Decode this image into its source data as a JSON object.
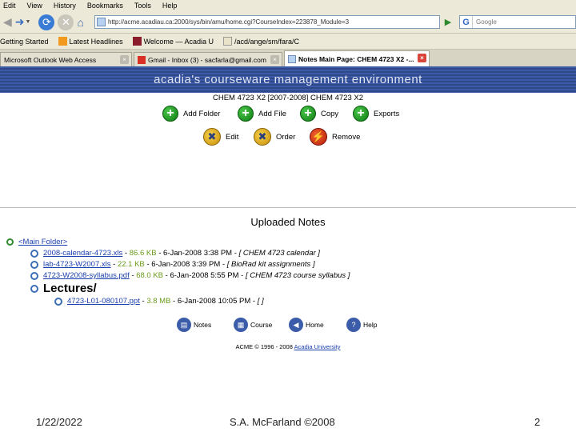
{
  "menu": [
    "Edit",
    "View",
    "History",
    "Bookmarks",
    "Tools",
    "Help"
  ],
  "nav": {
    "url": "http://acme.acadiau.ca:2000/sys/bin/amu/home.cgi?CourseIndex=223878_Module=3",
    "search_placeholder": "Google"
  },
  "bookmarks": [
    "Getting Started",
    "Latest Headlines",
    "Welcome — Acadia U",
    "/acd/ange/sm/fara/C"
  ],
  "tabs": [
    {
      "label": "Microsoft Outlook Web Access",
      "active": false
    },
    {
      "label": "Gmail - Inbox (3) - sacfarla@gmail.com",
      "active": false
    },
    {
      "label": "Notes Main Page: CHEM 4723 X2 -...",
      "active": true
    }
  ],
  "banner": "acadia's courseware management environment",
  "course_title": "CHEM 4723 X2 [2007-2008] CHEM 4723 X2",
  "actions": {
    "add_folder": "Add Folder",
    "add_file": "Add File",
    "copy": "Copy",
    "exports": "Exports",
    "edit": "Edit",
    "order": "Order",
    "remove": "Remove"
  },
  "uploaded_title": "Uploaded Notes",
  "main_folder": "<Main Folder>",
  "files": [
    {
      "name": "2008-calendar-4723.xls",
      "size": "86.6 KB",
      "date": "6-Jan-2008 3:38 PM",
      "desc": "[ CHEM 4723 calendar ]"
    },
    {
      "name": "lab-4723-W2007.xls",
      "size": "22.1 KB",
      "date": "6-Jan-2008 3:39 PM",
      "desc": "[ BioRad kit assignments ]"
    },
    {
      "name": "4723-W2008-syllabus.pdf",
      "size": "68.0 KB",
      "date": "6-Jan-2008 5:55 PM",
      "desc": "[ CHEM 4723 course syllabus ]"
    }
  ],
  "lectures_folder": "Lectures/",
  "lecture_files": [
    {
      "name": "4723-L01-080107.ppt",
      "size": "3.8 MB",
      "date": "6-Jan-2008 10:05 PM",
      "desc": "[ ]"
    }
  ],
  "bottom_nav": {
    "notes": "Notes",
    "course": "Course",
    "home": "Home",
    "help": "Help"
  },
  "copyright_prefix": "ACME © 1996 - 2008",
  "copyright_link": "Acadia University",
  "slide": {
    "date": "1/22/2022",
    "author": "S.A. McFarland ©2008",
    "page": "2"
  }
}
